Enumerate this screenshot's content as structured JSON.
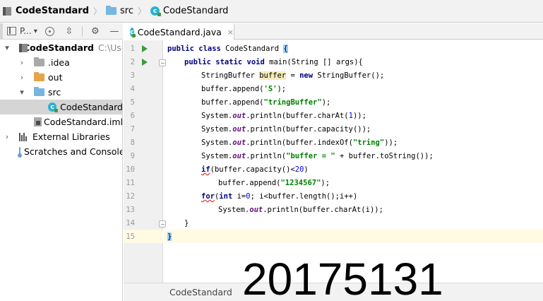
{
  "breadcrumb": {
    "project": "CodeStandard",
    "folder": "src",
    "file": "CodeStandard"
  },
  "project_panel": {
    "view_label": "P...",
    "view_dropdown": "▾",
    "tree": [
      {
        "label": "CodeStandard",
        "path": "C:\\Use",
        "expander": "▾"
      },
      {
        "label": ".idea",
        "expander": "›"
      },
      {
        "label": "out",
        "expander": "›"
      },
      {
        "label": "src",
        "expander": "▾"
      },
      {
        "label": "CodeStandard"
      },
      {
        "label": "CodeStandard.iml"
      },
      {
        "label": "External Libraries",
        "expander": "›"
      },
      {
        "label": "Scratches and Consoles"
      }
    ]
  },
  "editor": {
    "tab_label": "CodeStandard.java",
    "tab_close": "×",
    "line_numbers": [
      "1",
      "2",
      "3",
      "4",
      "5",
      "6",
      "7",
      "8",
      "9",
      "10",
      "11",
      "12",
      "13",
      "14",
      "15"
    ],
    "code": {
      "l1": {
        "kw": "public class",
        "rest": " CodeStandard ",
        "brace": "{"
      },
      "l2": {
        "kw1": "public static void",
        "rest": " main(String [] args){"
      },
      "l3": {
        "a": "StringBuffer ",
        "var": "buffer",
        "b": " = ",
        "kw": "new",
        "c": " StringBuffer();"
      },
      "l4": {
        "a": "buffer.append(",
        "str": "'S'",
        "b": ");"
      },
      "l5": {
        "a": "buffer.append(",
        "str": "\"tringBuffer\"",
        "b": ");"
      },
      "l6": {
        "a": "System.",
        "fld": "out",
        "b": ".println(buffer.charAt(",
        "num": "1",
        "c": "));"
      },
      "l7": {
        "a": "System.",
        "fld": "out",
        "b": ".println(buffer.capacity());"
      },
      "l8": {
        "a": "System.",
        "fld": "out",
        "b": ".println(buffer.indexOf(",
        "str": "\"tring\"",
        "c": "));"
      },
      "l9": {
        "a": "System.",
        "fld": "out",
        "b": ".println(",
        "str": "\"buffer = \"",
        "c": " + buffer.toString());"
      },
      "l10": {
        "kw": "if",
        "a": "(buffer.capacity()<",
        "num": "20",
        "b": ")"
      },
      "l11": {
        "a": "buffer.append(",
        "str": "\"1234567\"",
        "b": ");"
      },
      "l12": {
        "kw1": "for",
        "a": "(",
        "kw2": "int",
        "b": " i=",
        "num": "0",
        "c": "; i<buffer.length();i++)"
      },
      "l13": {
        "a": "System.",
        "fld": "out",
        "b": ".println(buffer.charAt(i));"
      },
      "l14": {
        "a": "}"
      },
      "l15": {
        "a": "}"
      }
    },
    "bottom_breadcrumb": "CodeStandard"
  },
  "watermark": "20175131"
}
